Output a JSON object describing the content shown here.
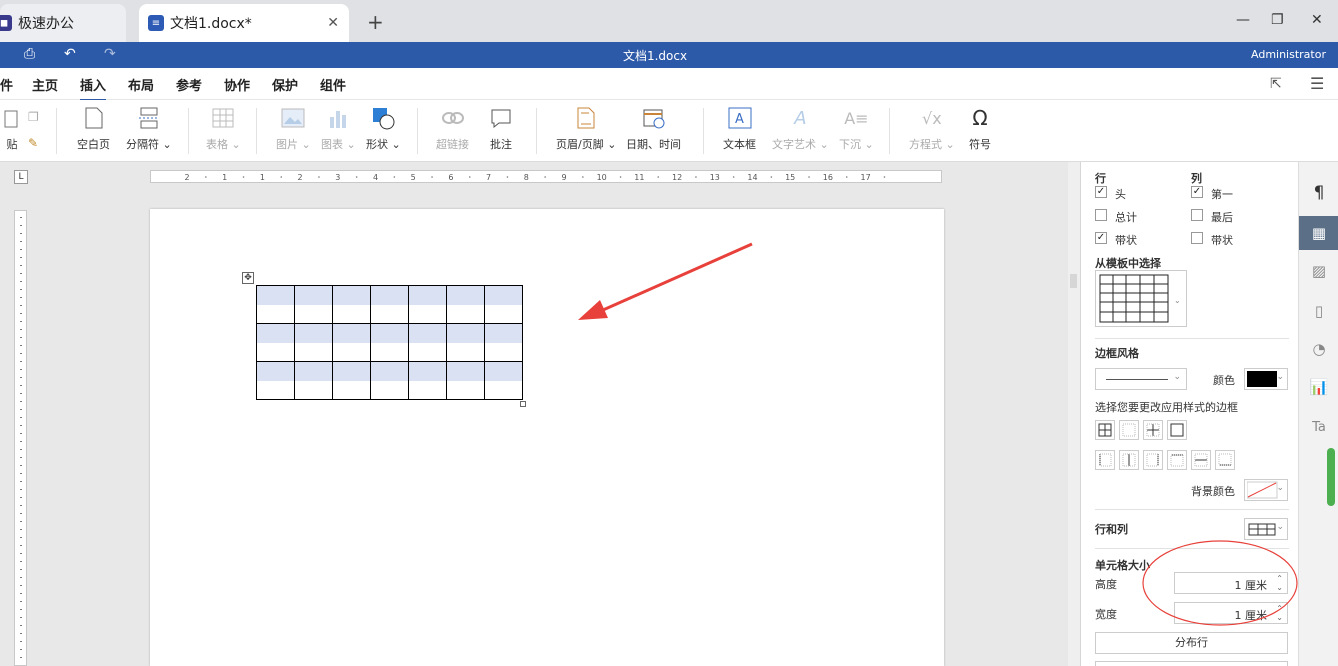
{
  "tabs": [
    {
      "label": "极速办公",
      "icon": "app-logo-icon"
    },
    {
      "label": "文档1.docx*",
      "icon": "document-icon"
    }
  ],
  "window": {
    "title": "文档1.docx",
    "user": "Administrator"
  },
  "menu": {
    "items": [
      "件",
      "主页",
      "插入",
      "布局",
      "参考",
      "协作",
      "保护",
      "组件"
    ],
    "active": "插入"
  },
  "ribbon": {
    "paste": "贴",
    "blank_page": "空白页",
    "separator": "分隔符",
    "table": "表格",
    "image": "图片",
    "chart": "图表",
    "shape": "形状",
    "hyperlink": "超链接",
    "comment": "批注",
    "header_footer": "页眉/页脚",
    "datetime": "日期、时间",
    "textbox": "文本框",
    "textart": "文字艺术",
    "dropcap": "下沉",
    "equation": "方程式",
    "symbol": "符号"
  },
  "ruler": {
    "marks": [
      "2",
      "1",
      "1",
      "2",
      "3",
      "4",
      "5",
      "6",
      "7",
      "8",
      "9",
      "10",
      "11",
      "12",
      "13",
      "14",
      "15",
      "16",
      "17"
    ]
  },
  "panel": {
    "rows_label": "行",
    "cols_label": "列",
    "row_options": [
      {
        "label": "头",
        "checked": true
      },
      {
        "label": "总计",
        "checked": false
      },
      {
        "label": "带状",
        "checked": true
      }
    ],
    "col_options": [
      {
        "label": "第一",
        "checked": true
      },
      {
        "label": "最后",
        "checked": false
      },
      {
        "label": "带状",
        "checked": false
      }
    ],
    "template_label": "从模板中选择",
    "border_style_label": "边框风格",
    "color_label": "颜色",
    "border_color": "#000000",
    "border_apply_label": "选择您要更改应用样式的边框",
    "bg_color_label": "背景颜色",
    "rows_cols_label": "行和列",
    "cell_size_label": "单元格大小",
    "height_label": "高度",
    "height_value": "1 厘米",
    "width_label": "宽度",
    "width_value": "1 厘米",
    "distribute_rows": "分布行"
  },
  "colors": {
    "accent": "#2d5aa8",
    "band": "#d9e1f2",
    "annotation": "#e8403a"
  }
}
